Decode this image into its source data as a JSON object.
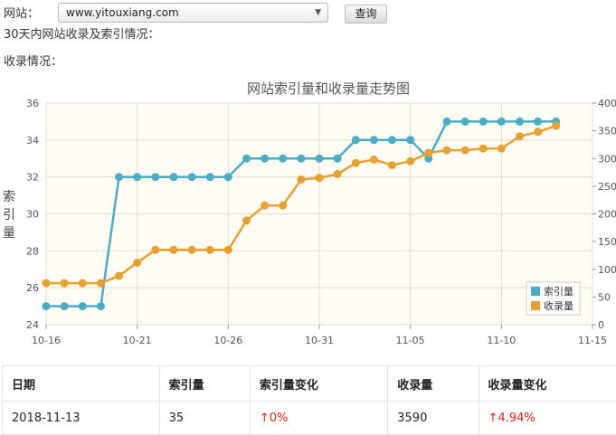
{
  "form": {
    "site_label": "网站：",
    "site_value": "www.yitouxiang.com",
    "query_label": "查询"
  },
  "headline": "30天内网站收录及索引情况：",
  "section_label": "收录情况：",
  "chart_data": {
    "type": "line",
    "title": "网站索引量和收录量走势图",
    "ylabel": "索引量",
    "x_tick_labels": [
      "10-16",
      "10-21",
      "10-26",
      "10-31",
      "11-05",
      "11-10",
      "11-15"
    ],
    "x_start": "2018-10-16",
    "x_end": "2018-11-15",
    "ylim_left": [
      24,
      36
    ],
    "yticks_left": [
      24,
      26,
      28,
      30,
      32,
      34,
      36
    ],
    "ylim_right": [
      0,
      400
    ],
    "yticks_right": [
      0,
      50,
      100,
      150,
      200,
      250,
      300,
      350,
      400
    ],
    "grid": true,
    "legend": "bottom-right",
    "series": [
      {
        "name": "索引量",
        "axis": "left",
        "color": "#4bacc6",
        "x": [
          "2018-10-16",
          "2018-10-17",
          "2018-10-18",
          "2018-10-19",
          "2018-10-20",
          "2018-10-21",
          "2018-10-22",
          "2018-10-23",
          "2018-10-24",
          "2018-10-25",
          "2018-10-26",
          "2018-10-27",
          "2018-10-28",
          "2018-10-29",
          "2018-10-30",
          "2018-10-31",
          "2018-11-01",
          "2018-11-02",
          "2018-11-03",
          "2018-11-04",
          "2018-11-05",
          "2018-11-06",
          "2018-11-07",
          "2018-11-08",
          "2018-11-09",
          "2018-11-10",
          "2018-11-11",
          "2018-11-12",
          "2018-11-13"
        ],
        "values": [
          25,
          25,
          25,
          25,
          32,
          32,
          32,
          32,
          32,
          32,
          32,
          33,
          33,
          33,
          33,
          33,
          33,
          34,
          34,
          34,
          34,
          33,
          35,
          35,
          35,
          35,
          35,
          35,
          35
        ]
      },
      {
        "name": "收录量",
        "axis": "right",
        "color": "#e8a030",
        "x": [
          "2018-10-16",
          "2018-10-17",
          "2018-10-18",
          "2018-10-19",
          "2018-10-20",
          "2018-10-21",
          "2018-10-22",
          "2018-10-23",
          "2018-10-24",
          "2018-10-25",
          "2018-10-26",
          "2018-10-27",
          "2018-10-28",
          "2018-10-29",
          "2018-10-30",
          "2018-10-31",
          "2018-11-01",
          "2018-11-02",
          "2018-11-03",
          "2018-11-04",
          "2018-11-05",
          "2018-11-06",
          "2018-11-07",
          "2018-11-08",
          "2018-11-09",
          "2018-11-10",
          "2018-11-11",
          "2018-11-12",
          "2018-11-13"
        ],
        "values": [
          75,
          75,
          75,
          75,
          88,
          112,
          135,
          135,
          135,
          135,
          135,
          188,
          215,
          215,
          262,
          265,
          272,
          292,
          298,
          288,
          295,
          310,
          315,
          315,
          318,
          318,
          340,
          348,
          359
        ]
      }
    ]
  },
  "table": {
    "headers": [
      "日期",
      "索引量",
      "索引量变化",
      "收录量",
      "收录量变化"
    ],
    "rows": [
      [
        "2018-11-13",
        "35",
        "↑0%",
        "3590",
        "↑4.94%"
      ]
    ]
  }
}
